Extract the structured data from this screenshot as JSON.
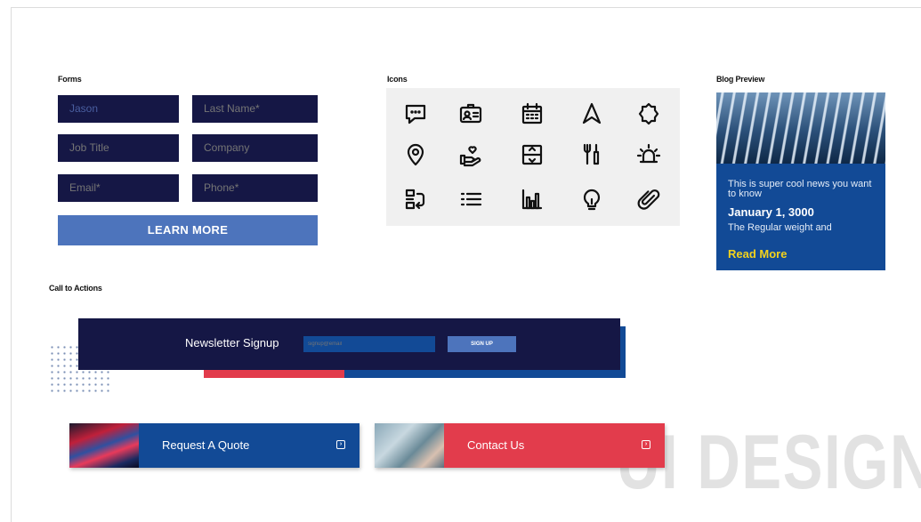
{
  "sections": {
    "forms": "Forms",
    "icons": "Icons",
    "blog": "Blog Preview",
    "cta": "Call to Actions"
  },
  "form": {
    "first_name": "Jason",
    "last_name_placeholder": "Last Name*",
    "job_title_placeholder": "Job Title",
    "company_placeholder": "Company",
    "email_placeholder": "Email*",
    "phone_placeholder": "Phone*",
    "submit_label": "LEARN MORE"
  },
  "icons": [
    "chat-icon",
    "id-card-icon",
    "calendar-icon",
    "navigation-arrow-icon",
    "badge-icon",
    "location-pin-icon",
    "hand-heart-icon",
    "document-expand-icon",
    "tools-icon",
    "alarm-light-icon",
    "transfer-icon",
    "list-icon",
    "bar-chart-icon",
    "lightbulb-icon",
    "paperclip-icon"
  ],
  "blog": {
    "summary": "This is super cool news you want to know",
    "date": "January 1, 3000",
    "excerpt": "The Regular weight and",
    "read_more": "Read More"
  },
  "newsletter": {
    "title": "Newsletter Signup",
    "email_placeholder": "signup@email",
    "button": "SIGN UP"
  },
  "cta_buttons": {
    "quote": "Request A Quote",
    "contact": "Contact Us"
  },
  "watermark": "UI DESIGN",
  "colors": {
    "navy": "#151745",
    "blue": "#124a96",
    "accent_blue": "#4d74bc",
    "red": "#e23c4c",
    "yellow": "#f3d21c"
  }
}
